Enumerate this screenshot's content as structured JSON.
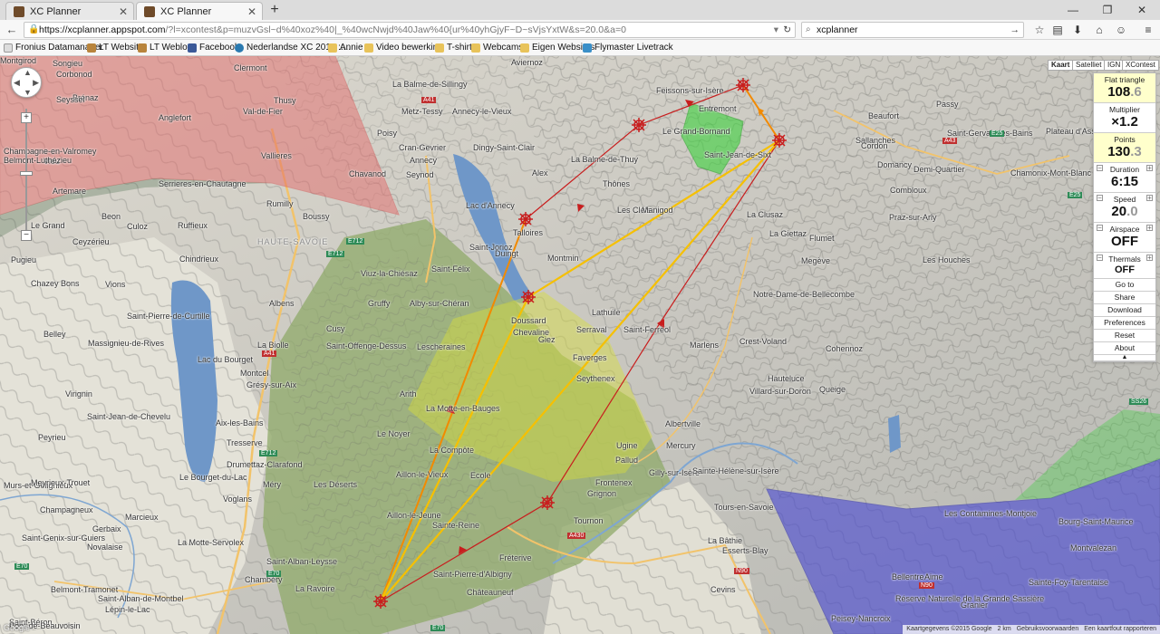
{
  "browser": {
    "tabs": [
      {
        "title": "XC Planner",
        "active": false
      },
      {
        "title": "XC Planner",
        "active": true
      }
    ],
    "url": {
      "host": "https://xcplanner.appspot.com",
      "rest": "/?l=xcontest&p=muzvGsl~d%40xoz%40|_%40wcNwjd%40Jaw%40{ur%40yhGjyF~D~sVjsYxtW&s=20.0&a=0"
    },
    "search_value": "xcplanner",
    "bookmarks": [
      "Fronius Datamanager",
      "LT Website",
      "LT Weblog",
      "Facebook",
      "Nederlandse XC 2014 ::...",
      "Annie",
      "Video bewerking",
      "T-shirt",
      "Webcams",
      "Eigen Websites",
      "Flymaster Livetrack"
    ]
  },
  "map": {
    "map_types": [
      "Kaart",
      "Satelliet",
      "IGN",
      "XContest"
    ],
    "places": [
      {
        "t": "Songieu"
      },
      {
        "t": "Corbonod"
      },
      {
        "t": "Brénaz"
      },
      {
        "t": "Seyssel"
      },
      {
        "t": "Clermont"
      },
      {
        "t": "Thusy"
      },
      {
        "t": "Val-de-Fier"
      },
      {
        "t": "Anglefort"
      },
      {
        "t": "Champagne-en-Valromey"
      },
      {
        "t": "Vieu"
      },
      {
        "t": "Vallieres"
      },
      {
        "t": "Chavanod"
      },
      {
        "t": "Artemare"
      },
      {
        "t": "Belmont-Luthézieu"
      },
      {
        "t": "Serrieres-en-Chautagne"
      },
      {
        "t": "Rumilly"
      },
      {
        "t": "Boussy"
      },
      {
        "t": "Beon"
      },
      {
        "t": "Ruffieux"
      },
      {
        "t": "Culoz"
      },
      {
        "t": "Le Grand"
      },
      {
        "t": "Ceyzérieu"
      },
      {
        "t": "Chindrieux"
      },
      {
        "t": "HAUTE-SAVOIE"
      },
      {
        "t": "Pugieu"
      },
      {
        "t": "Chazey Bons"
      },
      {
        "t": "Vions"
      },
      {
        "t": "Belley"
      },
      {
        "t": "Massignieu-de-Rives"
      },
      {
        "t": "Saint-Pierre-de-Curtille"
      },
      {
        "t": "Lac du Bourget"
      },
      {
        "t": "Virignin"
      },
      {
        "t": "Saint-Jean-de-Chevelu"
      },
      {
        "t": "Aix-les-Bains"
      },
      {
        "t": "Tresserve"
      },
      {
        "t": "Drumettaz-Clarafond"
      },
      {
        "t": "Le Bourget-du-Lac"
      },
      {
        "t": "Voglans"
      },
      {
        "t": "Méry"
      },
      {
        "t": "Chambéry"
      },
      {
        "t": "La Ravoire"
      },
      {
        "t": "Saint-Alban-Leysse"
      },
      {
        "t": "Peyrieu"
      },
      {
        "t": "Murs-et-Gélignieux"
      },
      {
        "t": "Meyrieux-Trouet"
      },
      {
        "t": "Champagneux"
      },
      {
        "t": "Gerbaix"
      },
      {
        "t": "Marcieux"
      },
      {
        "t": "Novalaise"
      },
      {
        "t": "La Motte-Servolex"
      },
      {
        "t": "Saint-Genix-sur-Guiers"
      },
      {
        "t": "Belmont-Tramonet"
      },
      {
        "t": "Saint-Alban-de-Montbel"
      },
      {
        "t": "Lépin-le-Lac"
      },
      {
        "t": "Saint-Béron"
      },
      {
        "t": "Pont-de-Beauvoisin"
      },
      {
        "t": "Annecy"
      },
      {
        "t": "Annecy-le-Vieux"
      },
      {
        "t": "Cran-Gevrier"
      },
      {
        "t": "Seynod"
      },
      {
        "t": "Metz-Tessy"
      },
      {
        "t": "Poisy"
      },
      {
        "t": "La Balme-de-Sillingy"
      },
      {
        "t": "Aviernoz"
      },
      {
        "t": "Dingy-Saint-Clair"
      },
      {
        "t": "Alex"
      },
      {
        "t": "La Balme-de-Thuy"
      },
      {
        "t": "Thônes"
      },
      {
        "t": "Les Clefs"
      },
      {
        "t": "Manigod"
      },
      {
        "t": "Lac d'Annecy"
      },
      {
        "t": "Talloires"
      },
      {
        "t": "Saint-Jorioz"
      },
      {
        "t": "Duingt"
      },
      {
        "t": "Viuz-la-Chiésaz"
      },
      {
        "t": "Saint-Félix"
      },
      {
        "t": "Gruffy"
      },
      {
        "t": "Alby-sur-Chéran"
      },
      {
        "t": "Albens"
      },
      {
        "t": "Cusy"
      },
      {
        "t": "La Biolle"
      },
      {
        "t": "Saint-Offenge-Dessus"
      },
      {
        "t": "Montcel"
      },
      {
        "t": "Grésy-sur-Aix"
      },
      {
        "t": "Lescheraines"
      },
      {
        "t": "Arith"
      },
      {
        "t": "La Motte-en-Bauges"
      },
      {
        "t": "Le Noyer"
      },
      {
        "t": "La Compôte"
      },
      {
        "t": "Aillon-le-Vieux"
      },
      {
        "t": "Ecole"
      },
      {
        "t": "Les Déserts"
      },
      {
        "t": "Aillon-le-Jeune"
      },
      {
        "t": "Sainte-Reine"
      },
      {
        "t": "Saint-Pierre-d'Albigny"
      },
      {
        "t": "Châteauneuf"
      },
      {
        "t": "Fréterive"
      },
      {
        "t": "Doussard"
      },
      {
        "t": "Chevaline"
      },
      {
        "t": "Giez"
      },
      {
        "t": "Faverges"
      },
      {
        "t": "Seythenex"
      },
      {
        "t": "Montmin"
      },
      {
        "t": "Lathuile"
      },
      {
        "t": "Serraval"
      },
      {
        "t": "Saint-Ferréol"
      },
      {
        "t": "Marlens"
      },
      {
        "t": "Ugine"
      },
      {
        "t": "Mercury"
      },
      {
        "t": "Albertville"
      },
      {
        "t": "Pallud"
      },
      {
        "t": "Gilly-sur-Isère"
      },
      {
        "t": "Grignon"
      },
      {
        "t": "Frontenex"
      },
      {
        "t": "Tournon"
      },
      {
        "t": "Sainte-Hélène-sur-Isère"
      },
      {
        "t": "Tours-en-Savoie"
      },
      {
        "t": "La Bâthie"
      },
      {
        "t": "Esserts-Blay"
      },
      {
        "t": "Cevins"
      },
      {
        "t": "Feissons-sur-Isère"
      },
      {
        "t": "Entremont"
      },
      {
        "t": "Le Grand-Bornand"
      },
      {
        "t": "Saint-Jean-de-Sixt"
      },
      {
        "t": "La Clusaz"
      },
      {
        "t": "La Giettaz"
      },
      {
        "t": "Flumet"
      },
      {
        "t": "Praz-sur-Arly"
      },
      {
        "t": "Megève"
      },
      {
        "t": "Notre-Dame-de-Bellecombe"
      },
      {
        "t": "Crest-Voland"
      },
      {
        "t": "Cohennoz"
      },
      {
        "t": "Hauteluce"
      },
      {
        "t": "Villard-sur-Doron"
      },
      {
        "t": "Queige"
      },
      {
        "t": "Beaufort"
      },
      {
        "t": "Sallanches"
      },
      {
        "t": "Cordon"
      },
      {
        "t": "Domancy"
      },
      {
        "t": "Combloux"
      },
      {
        "t": "Demi-Quartier"
      },
      {
        "t": "Saint-Gervais-les-Bains"
      },
      {
        "t": "Passy"
      },
      {
        "t": "Plateau d'Assy"
      },
      {
        "t": "Chamonix-Mont-Blanc"
      },
      {
        "t": "Les Houches"
      },
      {
        "t": "Les Contamines-Montjoie"
      },
      {
        "t": "Bourg-Saint-Maurice"
      },
      {
        "t": "Montvalezan"
      },
      {
        "t": "Sainte-Foy-Tarentaise"
      },
      {
        "t": "Réserve Naturelle de la Grande Sassière"
      },
      {
        "t": "Aime"
      },
      {
        "t": "Bellentre"
      },
      {
        "t": "Granier"
      },
      {
        "t": "Peisey-Nancroix"
      },
      {
        "t": "Montgirod"
      }
    ],
    "roads": [
      "E712",
      "E712",
      "A41",
      "A41",
      "E712",
      "E70",
      "E70",
      "E70",
      "A430",
      "N90",
      "N90",
      "E25",
      "E25",
      "SS26",
      "A43"
    ],
    "footer": {
      "attribution": "Kaartgegevens ©2015 Google",
      "scale": "2 km",
      "terms": "Gebruiksvoorwaarden",
      "report": "Een kaartfout rapporteren"
    }
  },
  "panel": {
    "flight_type": {
      "label": "Flat triangle",
      "value_main": "108",
      "value_dim": ".6"
    },
    "multiplier": {
      "label": "Multiplier",
      "value": "×1.2"
    },
    "points": {
      "label": "Points",
      "value_main": "130",
      "value_dim": ".3"
    },
    "duration": {
      "label": "Duration",
      "value": "6:15"
    },
    "speed": {
      "label": "Speed",
      "value_main": "20",
      "value_dim": ".0"
    },
    "airspace": {
      "label": "Airspace",
      "value": "OFF"
    },
    "thermals": {
      "label": "Thermals",
      "value": "OFF"
    },
    "buttons": [
      "Go to",
      "Share",
      "Download",
      "Preferences",
      "Reset",
      "About"
    ]
  },
  "colors": {
    "route_red": "#c81e1e",
    "route_orange": "#f28a00",
    "route_yellow": "#f6c000",
    "airspace_red": "#e36b6b",
    "airspace_blue": "#3b3bd6",
    "airspace_green": "#3cd23c",
    "airspace_yellow": "#d8de3a"
  }
}
